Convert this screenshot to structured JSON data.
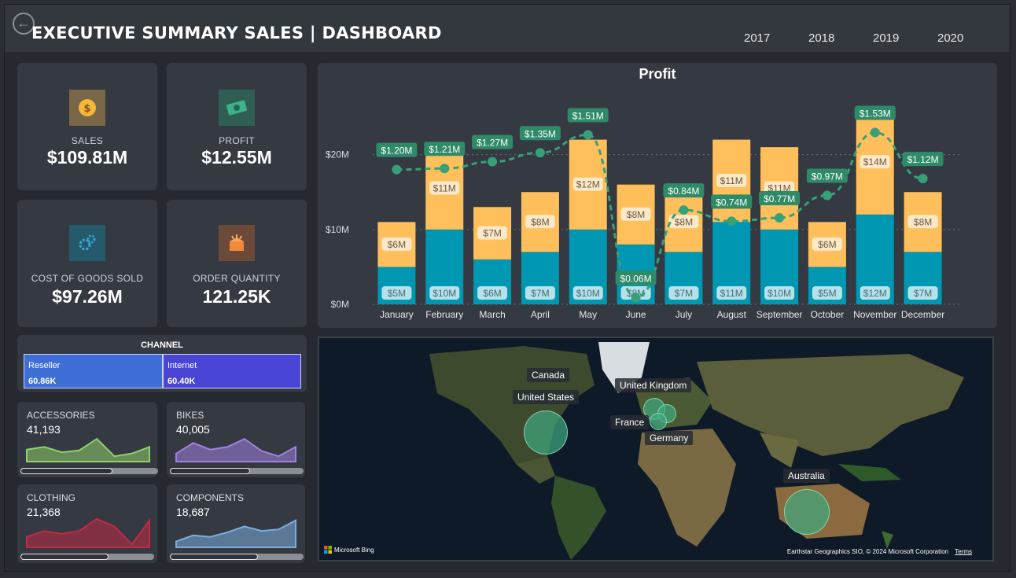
{
  "header": {
    "title": "EXECUTIVE SUMMARY SALES | DASHBOARD",
    "years": [
      "2017",
      "2018",
      "2019",
      "2020"
    ]
  },
  "kpis": {
    "sales": {
      "label": "SALES",
      "value": "$109.81M",
      "icon": "dollar-coin-icon",
      "color": "#7a6748"
    },
    "profit": {
      "label": "PROFIT",
      "value": "$12.55M",
      "icon": "money-icon",
      "color": "#2f5e53"
    },
    "cogs": {
      "label": "COST OF GOODS SOLD",
      "value": "$97.26M",
      "icon": "gears-icon",
      "color": "#245a6b"
    },
    "orders": {
      "label": "ORDER QUANTITY",
      "value": "121.25K",
      "icon": "box-icon",
      "color": "#6b4a3a"
    }
  },
  "channel": {
    "title": "CHANNEL",
    "items": [
      {
        "name": "Reseller",
        "value": "60.86K",
        "share": 0.502
      },
      {
        "name": "Internet",
        "value": "60.40K",
        "share": 0.498
      }
    ]
  },
  "categories": [
    {
      "name": "ACCESSORIES",
      "value": "41,193",
      "color": "#8fd06a",
      "progress": 0.67,
      "spark": [
        0.45,
        0.55,
        0.35,
        0.42,
        0.85,
        0.2,
        0.3,
        0.55
      ]
    },
    {
      "name": "BIKES",
      "value": "40,005",
      "color": "#9f83e0",
      "progress": 0.6,
      "spark": [
        0.3,
        0.7,
        0.45,
        0.55,
        0.85,
        0.4,
        0.2,
        0.55
      ]
    },
    {
      "name": "CLOTHING",
      "value": "21,368",
      "color": "#c02b45",
      "progress": 0.66,
      "spark": [
        0.35,
        0.55,
        0.45,
        0.55,
        0.95,
        0.7,
        0.1,
        0.9
      ]
    },
    {
      "name": "COMPONENTS",
      "value": "18,687",
      "color": "#7aaede",
      "progress": 0.66,
      "spark": [
        0.2,
        0.4,
        0.35,
        0.5,
        0.7,
        0.55,
        0.6,
        0.9
      ]
    }
  ],
  "profit_chart": {
    "title": "Profit",
    "y_ticks": [
      "$0M",
      "$10M",
      "$20M"
    ]
  },
  "chart_data": {
    "type": "bar",
    "title": "Profit",
    "categories": [
      "January",
      "February",
      "March",
      "April",
      "May",
      "June",
      "July",
      "August",
      "September",
      "October",
      "November",
      "December"
    ],
    "ylim": [
      0,
      27
    ],
    "y_ticks": [
      0,
      10,
      20
    ],
    "series": [
      {
        "values": [
          5,
          10,
          6,
          7,
          10,
          8,
          7,
          11,
          10,
          5,
          12,
          7
        ],
        "labels": [
          "$5M",
          "$10M",
          "$6M",
          "$7M",
          "$10M",
          "$8M",
          "$7M",
          "$11M",
          "$10M",
          "$5M",
          "$12M",
          "$7M"
        ],
        "color": "#0097b2"
      },
      {
        "values": [
          6,
          11,
          7,
          8,
          12,
          8,
          8,
          11,
          11,
          6,
          14,
          8
        ],
        "labels": [
          "$6M",
          "$11M",
          "$7M",
          "$8M",
          "$12M",
          "$8M",
          "$8M",
          "$11M",
          "$11M",
          "$6M",
          "$14M",
          "$8M"
        ],
        "color": "#ffbf5a"
      },
      {
        "type": "line",
        "values": [
          1.2,
          1.21,
          1.27,
          1.35,
          1.51,
          0.06,
          0.84,
          0.74,
          0.77,
          0.97,
          1.53,
          1.12
        ],
        "labels": [
          "$1.20M",
          "$1.21M",
          "$1.27M",
          "$1.35M",
          "$1.51M",
          "$0.06M",
          "$0.84M",
          "$0.74M",
          "$0.77M",
          "$0.97M",
          "$1.53M",
          "$1.12M"
        ],
        "color": "#36a07a",
        "ylim": [
          0,
          1.8
        ]
      }
    ]
  },
  "map": {
    "labels": [
      "Canada",
      "United States",
      "United Kingdom",
      "France",
      "Germany",
      "Australia"
    ],
    "bing": "Microsoft Bing",
    "credits": "Earthstar Geographics SIO, © 2024 Microsoft Corporation",
    "terms": "Terms"
  }
}
